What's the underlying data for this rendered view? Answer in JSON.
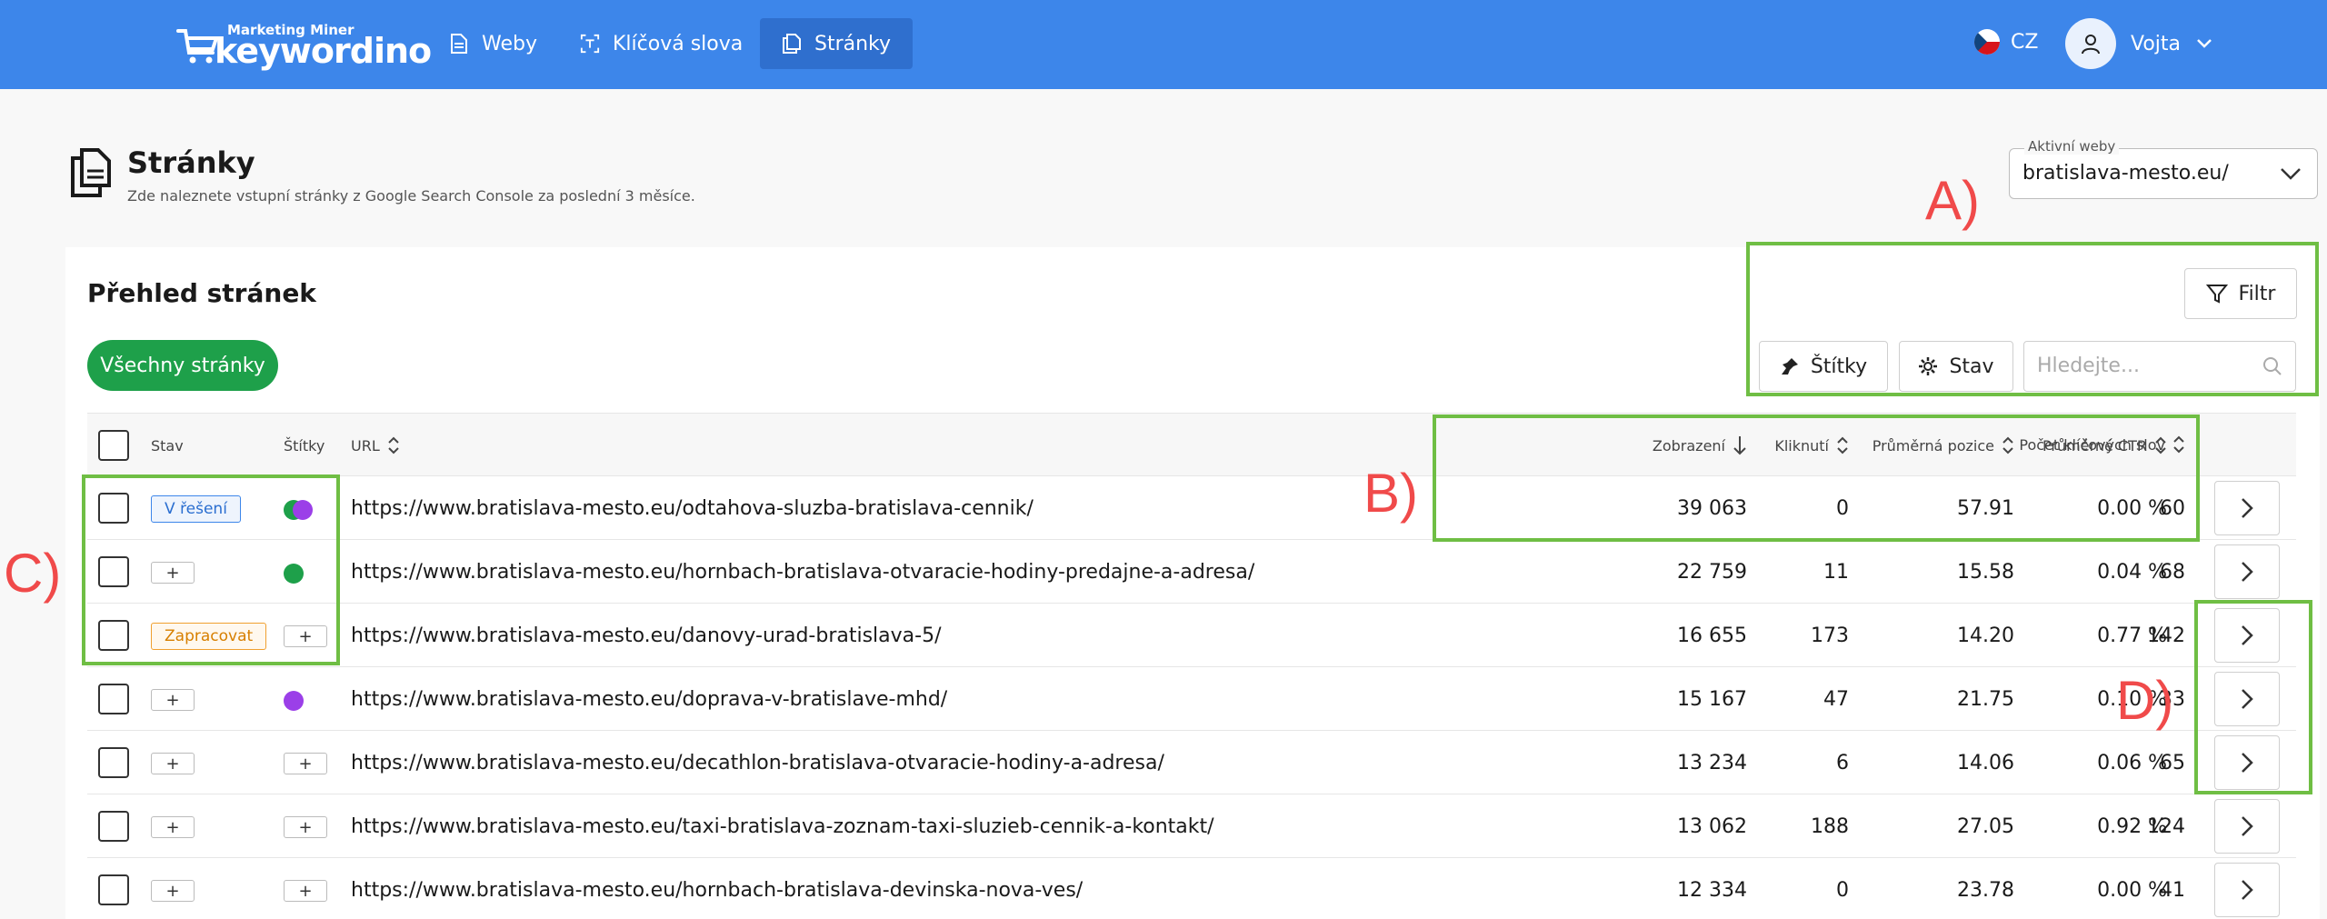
{
  "brand": {
    "small": "Marketing Miner",
    "name": "keywordino"
  },
  "nav": [
    {
      "label": "Weby",
      "icon": "document-icon",
      "active": false
    },
    {
      "label": "Klíčová slova",
      "icon": "text-frame-icon",
      "active": false
    },
    {
      "label": "Stránky",
      "icon": "pages-icon",
      "active": true
    }
  ],
  "lang": "CZ",
  "user": {
    "name": "Vojta"
  },
  "page": {
    "title": "Stránky",
    "subtitle": "Zde naleznete vstupní stránky z Google Search Console za poslední 3 měsíce."
  },
  "site_select": {
    "label": "Aktivní weby",
    "value": "bratislava-mesto.eu/"
  },
  "card": {
    "title": "Přehled stránek",
    "all_pages_label": "Všechny stránky"
  },
  "toolbar": {
    "filter_label": "Filtr",
    "tags_label": "Štítky",
    "state_label": "Stav",
    "search_placeholder": "Hledejte..."
  },
  "table": {
    "headers": {
      "state": "Stav",
      "tags": "Štítky",
      "url": "URL",
      "impressions": "Zobrazení",
      "clicks": "Kliknutí",
      "position": "Průměrná pozice",
      "ctr": "Průměrné CTR",
      "keywords": "Počet klíčových slov"
    },
    "rows": [
      {
        "state": "V řešení",
        "state_type": "blue",
        "tags": [
          "#1ea04a",
          "#9b3fe8"
        ],
        "url": "https://www.bratislava-mesto.eu/odtahova-sluzba-bratislava-cennik/",
        "impressions": "39 063",
        "clicks": "0",
        "position": "57.91",
        "ctr": "0.00 %",
        "keywords": "60"
      },
      {
        "state": "+",
        "state_type": "plus",
        "tags": [
          "#1ea04a"
        ],
        "url": "https://www.bratislava-mesto.eu/hornbach-bratislava-otvaracie-hodiny-predajne-a-adresa/",
        "impressions": "22 759",
        "clicks": "11",
        "position": "15.58",
        "ctr": "0.04 %",
        "keywords": "68"
      },
      {
        "state": "Zapracovat",
        "state_type": "orange",
        "tags": [],
        "url": "https://www.bratislava-mesto.eu/danovy-urad-bratislava-5/",
        "impressions": "16 655",
        "clicks": "173",
        "position": "14.20",
        "ctr": "0.77 %",
        "keywords": "142"
      },
      {
        "state": "+",
        "state_type": "plus",
        "tags": [
          "#9b3fe8"
        ],
        "url": "https://www.bratislava-mesto.eu/doprava-v-bratislave-mhd/",
        "impressions": "15 167",
        "clicks": "47",
        "position": "21.75",
        "ctr": "0.10 %",
        "keywords": "33"
      },
      {
        "state": "+",
        "state_type": "plus",
        "tags": [],
        "url": "https://www.bratislava-mesto.eu/decathlon-bratislava-otvaracie-hodiny-a-adresa/",
        "impressions": "13 234",
        "clicks": "6",
        "position": "14.06",
        "ctr": "0.06 %",
        "keywords": "65"
      },
      {
        "state": "+",
        "state_type": "plus",
        "tags": [],
        "url": "https://www.bratislava-mesto.eu/taxi-bratislava-zoznam-taxi-sluzieb-cennik-a-kontakt/",
        "impressions": "13 062",
        "clicks": "188",
        "position": "27.05",
        "ctr": "0.92 %",
        "keywords": "124"
      },
      {
        "state": "+",
        "state_type": "plus",
        "tags": [],
        "url": "https://www.bratislava-mesto.eu/hornbach-bratislava-devinska-nova-ves/",
        "impressions": "12 334",
        "clicks": "0",
        "position": "23.78",
        "ctr": "0.00 %",
        "keywords": "41"
      }
    ],
    "plus_label": "+"
  },
  "annotations": {
    "a": "A)",
    "b": "B)",
    "c": "C)",
    "d": "D)"
  },
  "colors": {
    "topbar": "#3d86ea",
    "accent_green": "#1ea04a",
    "annotation_box": "#6fbe44",
    "annotation_text": "#f04a4a"
  }
}
